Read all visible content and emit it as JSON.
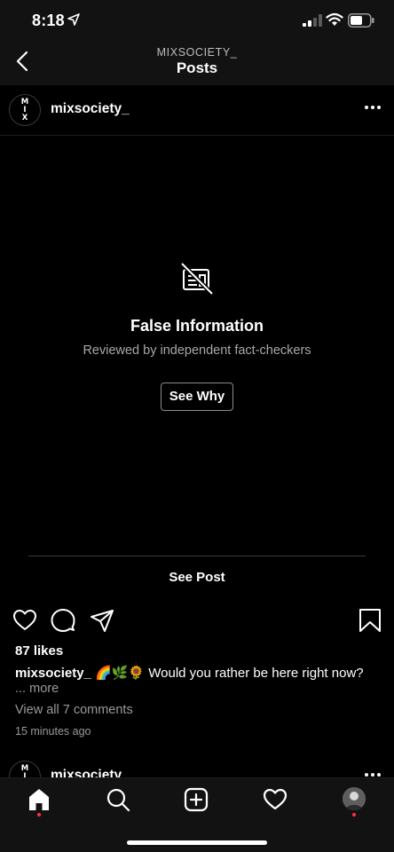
{
  "status": {
    "time": "8:18",
    "battery_level": 0.65
  },
  "nav": {
    "subtitle": "MIXSOCIETY_",
    "title": "Posts"
  },
  "post": {
    "avatar_text": "M\nI\nX",
    "username": "mixsociety_",
    "warning_title": "False Information",
    "warning_subtitle": "Reviewed by independent fact-checkers",
    "see_why_label": "See Why",
    "see_post_label": "See Post",
    "likes": "87 likes",
    "caption_user": "mixsociety_",
    "caption_text": " 🌈🌿🌻 Would you rather be here right now?",
    "more_label": "... more",
    "view_comments": "View all 7 comments",
    "time_ago": "15 minutes ago"
  },
  "next_post": {
    "username": "mixsociety_"
  },
  "tabs": [
    "home",
    "search",
    "new-post",
    "activity",
    "profile"
  ],
  "colors": {
    "background": "#000000",
    "bar": "#121212",
    "notification_dot": "#ff3040",
    "muted_text": "#9a9a9a"
  }
}
